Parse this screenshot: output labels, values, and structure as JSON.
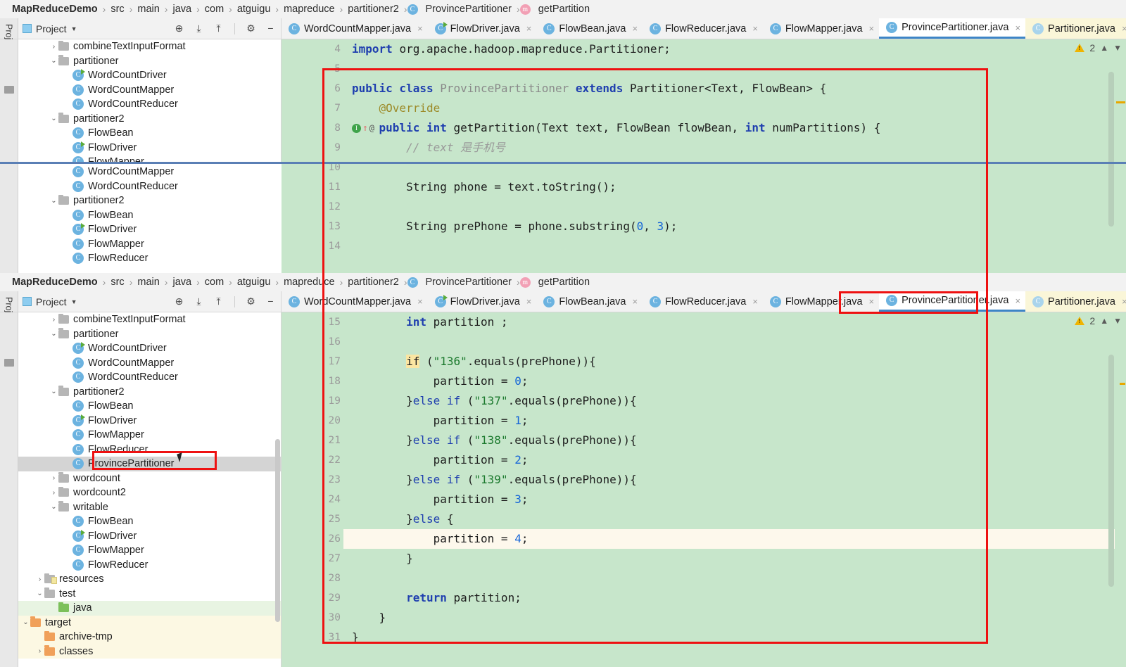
{
  "app": {
    "project_name": "MapReduceDemo",
    "tool_window_label": "Project",
    "panel_title": "Project"
  },
  "breadcrumb": {
    "items": [
      {
        "label": "MapReduceDemo",
        "icon": "none",
        "bold": true
      },
      {
        "label": "src",
        "icon": "none",
        "bold": false
      },
      {
        "label": "main",
        "icon": "none",
        "bold": false
      },
      {
        "label": "java",
        "icon": "none",
        "bold": false
      },
      {
        "label": "com",
        "icon": "none",
        "bold": false
      },
      {
        "label": "atguigu",
        "icon": "none",
        "bold": false
      },
      {
        "label": "mapreduce",
        "icon": "none",
        "bold": false
      },
      {
        "label": "partitioner2",
        "icon": "none",
        "bold": false
      },
      {
        "label": "ProvincePartitioner",
        "icon": "class-icon",
        "bold": false
      },
      {
        "label": "getPartition",
        "icon": "method-icon",
        "bold": false
      }
    ]
  },
  "toolbar": {
    "icons": [
      {
        "name": "locate-file-icon",
        "glyph": "⊕"
      },
      {
        "name": "collapse-all-icon",
        "glyph": "⤓"
      },
      {
        "name": "expand-all-icon",
        "glyph": "⤒"
      },
      {
        "name": "settings-gear-icon",
        "glyph": "⚙"
      },
      {
        "name": "hide-panel-icon",
        "glyph": "−"
      }
    ]
  },
  "tabs": [
    {
      "label": "WordCountMapper.java",
      "icon": "class-icon",
      "active": false,
      "style": "normal",
      "closable": true
    },
    {
      "label": "FlowDriver.java",
      "icon": "class-run-icon",
      "active": false,
      "style": "normal",
      "closable": true
    },
    {
      "label": "FlowBean.java",
      "icon": "class-icon",
      "active": false,
      "style": "normal",
      "closable": true
    },
    {
      "label": "FlowReducer.java",
      "icon": "class-icon",
      "active": false,
      "style": "normal",
      "closable": true
    },
    {
      "label": "FlowMapper.java",
      "icon": "class-icon",
      "active": false,
      "style": "normal",
      "closable": true
    },
    {
      "label": "ProvincePartitioner.java",
      "icon": "class-icon",
      "active": true,
      "style": "normal",
      "closable": true
    },
    {
      "label": "Partitioner.java",
      "icon": "class-pale-icon",
      "active": false,
      "style": "yellow",
      "closable": true
    }
  ],
  "tree_top": [
    {
      "label": "combineTextInputFormat",
      "indent": 2,
      "type": "folder",
      "arrow": "right",
      "color": "grey"
    },
    {
      "label": "partitioner",
      "indent": 2,
      "type": "folder",
      "arrow": "down",
      "color": "grey"
    },
    {
      "label": "WordCountDriver",
      "indent": 3,
      "type": "class-run",
      "arrow": "none"
    },
    {
      "label": "WordCountMapper",
      "indent": 3,
      "type": "class",
      "arrow": "none"
    },
    {
      "label": "WordCountReducer",
      "indent": 3,
      "type": "class",
      "arrow": "none"
    },
    {
      "label": "partitioner2",
      "indent": 2,
      "type": "folder",
      "arrow": "down",
      "color": "grey"
    },
    {
      "label": "FlowBean",
      "indent": 3,
      "type": "class",
      "arrow": "none"
    },
    {
      "label": "FlowDriver",
      "indent": 3,
      "type": "class-run",
      "arrow": "none"
    },
    {
      "label": "FlowMapper",
      "indent": 3,
      "type": "class",
      "arrow": "none"
    }
  ],
  "tree_mid": [
    {
      "label": "WordCountMapper",
      "indent": 3,
      "type": "class",
      "arrow": "none"
    },
    {
      "label": "WordCountReducer",
      "indent": 3,
      "type": "class",
      "arrow": "none"
    },
    {
      "label": "partitioner2",
      "indent": 2,
      "type": "folder",
      "arrow": "down",
      "color": "grey"
    },
    {
      "label": "FlowBean",
      "indent": 3,
      "type": "class",
      "arrow": "none"
    },
    {
      "label": "FlowDriver",
      "indent": 3,
      "type": "class-run",
      "arrow": "none"
    },
    {
      "label": "FlowMapper",
      "indent": 3,
      "type": "class",
      "arrow": "none"
    },
    {
      "label": "FlowReducer",
      "indent": 3,
      "type": "class",
      "arrow": "none"
    }
  ],
  "tree_bottom": [
    {
      "label": "combineTextInputFormat",
      "indent": 2,
      "type": "folder",
      "arrow": "right",
      "color": "grey",
      "state": "normal"
    },
    {
      "label": "partitioner",
      "indent": 2,
      "type": "folder",
      "arrow": "down",
      "color": "grey",
      "state": "normal"
    },
    {
      "label": "WordCountDriver",
      "indent": 3,
      "type": "class-run",
      "arrow": "none",
      "state": "normal"
    },
    {
      "label": "WordCountMapper",
      "indent": 3,
      "type": "class",
      "arrow": "none",
      "state": "normal"
    },
    {
      "label": "WordCountReducer",
      "indent": 3,
      "type": "class",
      "arrow": "none",
      "state": "normal"
    },
    {
      "label": "partitioner2",
      "indent": 2,
      "type": "folder",
      "arrow": "down",
      "color": "grey",
      "state": "normal"
    },
    {
      "label": "FlowBean",
      "indent": 3,
      "type": "class",
      "arrow": "none",
      "state": "normal"
    },
    {
      "label": "FlowDriver",
      "indent": 3,
      "type": "class-run",
      "arrow": "none",
      "state": "normal"
    },
    {
      "label": "FlowMapper",
      "indent": 3,
      "type": "class",
      "arrow": "none",
      "state": "normal"
    },
    {
      "label": "FlowReducer",
      "indent": 3,
      "type": "class",
      "arrow": "none",
      "state": "normal"
    },
    {
      "label": "ProvincePartitioner",
      "indent": 3,
      "type": "class",
      "arrow": "none",
      "state": "selected"
    },
    {
      "label": "wordcount",
      "indent": 2,
      "type": "folder",
      "arrow": "right",
      "color": "grey",
      "state": "normal"
    },
    {
      "label": "wordcount2",
      "indent": 2,
      "type": "folder",
      "arrow": "right",
      "color": "grey",
      "state": "normal"
    },
    {
      "label": "writable",
      "indent": 2,
      "type": "folder",
      "arrow": "down",
      "color": "grey",
      "state": "normal"
    },
    {
      "label": "FlowBean",
      "indent": 3,
      "type": "class",
      "arrow": "none",
      "state": "normal"
    },
    {
      "label": "FlowDriver",
      "indent": 3,
      "type": "class-run",
      "arrow": "none",
      "state": "normal"
    },
    {
      "label": "FlowMapper",
      "indent": 3,
      "type": "class",
      "arrow": "none",
      "state": "normal"
    },
    {
      "label": "FlowReducer",
      "indent": 3,
      "type": "class",
      "arrow": "none",
      "state": "normal"
    },
    {
      "label": "resources",
      "indent": 1,
      "type": "folder-res",
      "arrow": "right",
      "color": "grey",
      "state": "normal"
    },
    {
      "label": "test",
      "indent": 1,
      "type": "folder",
      "arrow": "down",
      "color": "grey",
      "state": "normal"
    },
    {
      "label": "java",
      "indent": 2,
      "type": "folder",
      "arrow": "none",
      "color": "green",
      "state": "green"
    },
    {
      "label": "target",
      "indent": 0,
      "type": "folder",
      "arrow": "down",
      "color": "orange",
      "state": "yellow"
    },
    {
      "label": "archive-tmp",
      "indent": 1,
      "type": "folder",
      "arrow": "none",
      "color": "orange",
      "state": "yellow"
    },
    {
      "label": "classes",
      "indent": 1,
      "type": "folder",
      "arrow": "right",
      "color": "orange",
      "state": "yellow"
    }
  ],
  "editor_top": {
    "warning_count": "2",
    "lines": [
      {
        "num": "4",
        "tokens": [
          {
            "t": "import ",
            "c": "kw"
          },
          {
            "t": "org.apache.hadoop.mapreduce.Partitioner;",
            "c": "pl"
          }
        ]
      },
      {
        "num": "5",
        "tokens": []
      },
      {
        "num": "6",
        "tokens": [
          {
            "t": "public class ",
            "c": "kw"
          },
          {
            "t": "ProvincePartitioner ",
            "c": "typ"
          },
          {
            "t": "extends ",
            "c": "kw"
          },
          {
            "t": "Partitioner<Text, FlowBean> {",
            "c": "pl"
          }
        ]
      },
      {
        "num": "7",
        "tokens": [
          {
            "t": "    @Override",
            "c": "ann"
          }
        ]
      },
      {
        "num": "8",
        "tokens": [
          {
            "t": "    ",
            "c": "pl"
          },
          {
            "t": "public int ",
            "c": "kw"
          },
          {
            "t": "getPartition(Text text, FlowBean flowBean, ",
            "c": "pl"
          },
          {
            "t": "int ",
            "c": "kw"
          },
          {
            "t": "numPartitions) {",
            "c": "pl"
          }
        ],
        "gutter_icons": [
          "implements-icon",
          "override-arrow-icon",
          "annotation-icon"
        ]
      },
      {
        "num": "9",
        "tokens": [
          {
            "t": "        // text 是手机号",
            "c": "cmt"
          }
        ]
      },
      {
        "num": "10",
        "tokens": []
      },
      {
        "num": "11",
        "tokens": [
          {
            "t": "        String phone = text.toString();",
            "c": "pl"
          }
        ]
      },
      {
        "num": "12",
        "tokens": []
      },
      {
        "num": "13",
        "tokens": [
          {
            "t": "        String prePhone = phone.substring(",
            "c": "pl"
          },
          {
            "t": "0",
            "c": "num"
          },
          {
            "t": ", ",
            "c": "pl"
          },
          {
            "t": "3",
            "c": "num"
          },
          {
            "t": ");",
            "c": "pl"
          }
        ]
      },
      {
        "num": "14",
        "tokens": []
      }
    ]
  },
  "editor_bottom": {
    "warning_count": "2",
    "lines": [
      {
        "num": "15",
        "tokens": [
          {
            "t": "        ",
            "c": "pl"
          },
          {
            "t": "int ",
            "c": "kw"
          },
          {
            "t": "partition ;",
            "c": "pl"
          }
        ]
      },
      {
        "num": "16",
        "tokens": []
      },
      {
        "num": "17",
        "tokens": [
          {
            "t": "        ",
            "c": "pl"
          },
          {
            "t": "if",
            "c": "ifhl"
          },
          {
            "t": " (",
            "c": "pl"
          },
          {
            "t": "\"136\"",
            "c": "str"
          },
          {
            "t": ".equals(prePhone)){",
            "c": "pl"
          }
        ]
      },
      {
        "num": "18",
        "tokens": [
          {
            "t": "            partition = ",
            "c": "pl"
          },
          {
            "t": "0",
            "c": "num"
          },
          {
            "t": ";",
            "c": "pl"
          }
        ]
      },
      {
        "num": "19",
        "tokens": [
          {
            "t": "        }",
            "c": "pl"
          },
          {
            "t": "else if ",
            "c": "kw2"
          },
          {
            "t": "(",
            "c": "pl"
          },
          {
            "t": "\"137\"",
            "c": "str"
          },
          {
            "t": ".equals(prePhone)){",
            "c": "pl"
          }
        ]
      },
      {
        "num": "20",
        "tokens": [
          {
            "t": "            partition = ",
            "c": "pl"
          },
          {
            "t": "1",
            "c": "num"
          },
          {
            "t": ";",
            "c": "pl"
          }
        ]
      },
      {
        "num": "21",
        "tokens": [
          {
            "t": "        }",
            "c": "pl"
          },
          {
            "t": "else if ",
            "c": "kw2"
          },
          {
            "t": "(",
            "c": "pl"
          },
          {
            "t": "\"138\"",
            "c": "str"
          },
          {
            "t": ".equals(prePhone)){",
            "c": "pl"
          }
        ]
      },
      {
        "num": "22",
        "tokens": [
          {
            "t": "            partition = ",
            "c": "pl"
          },
          {
            "t": "2",
            "c": "num"
          },
          {
            "t": ";",
            "c": "pl"
          }
        ]
      },
      {
        "num": "23",
        "tokens": [
          {
            "t": "        }",
            "c": "pl"
          },
          {
            "t": "else if ",
            "c": "kw2"
          },
          {
            "t": "(",
            "c": "pl"
          },
          {
            "t": "\"139\"",
            "c": "str"
          },
          {
            "t": ".equals(prePhone)){",
            "c": "pl"
          }
        ]
      },
      {
        "num": "24",
        "tokens": [
          {
            "t": "            partition = ",
            "c": "pl"
          },
          {
            "t": "3",
            "c": "num"
          },
          {
            "t": ";",
            "c": "pl"
          }
        ]
      },
      {
        "num": "25",
        "tokens": [
          {
            "t": "        }",
            "c": "pl"
          },
          {
            "t": "else ",
            "c": "kw2"
          },
          {
            "t": "{",
            "c": "pl"
          }
        ]
      },
      {
        "num": "26",
        "tokens": [
          {
            "t": "            partition = ",
            "c": "pl"
          },
          {
            "t": "4",
            "c": "num"
          },
          {
            "t": ";",
            "c": "pl"
          }
        ],
        "highlight": true
      },
      {
        "num": "27",
        "tokens": [
          {
            "t": "        }",
            "c": "pl"
          }
        ]
      },
      {
        "num": "28",
        "tokens": []
      },
      {
        "num": "29",
        "tokens": [
          {
            "t": "        ",
            "c": "pl"
          },
          {
            "t": "return ",
            "c": "kw"
          },
          {
            "t": "partition;",
            "c": "pl"
          }
        ]
      },
      {
        "num": "30",
        "tokens": [
          {
            "t": "    }",
            "c": "pl"
          }
        ]
      },
      {
        "num": "31",
        "tokens": [
          {
            "t": "}",
            "c": "pl"
          }
        ]
      }
    ]
  },
  "colors": {
    "editor_background": "#c7e6cb",
    "annotation_red": "#ee1111",
    "active_tab_underline": "#3d85c6",
    "keyword_blue": "#1f3faf",
    "string_green": "#1c7a2e",
    "number_blue": "#1565d8",
    "warning_yellow": "#f0b400"
  }
}
